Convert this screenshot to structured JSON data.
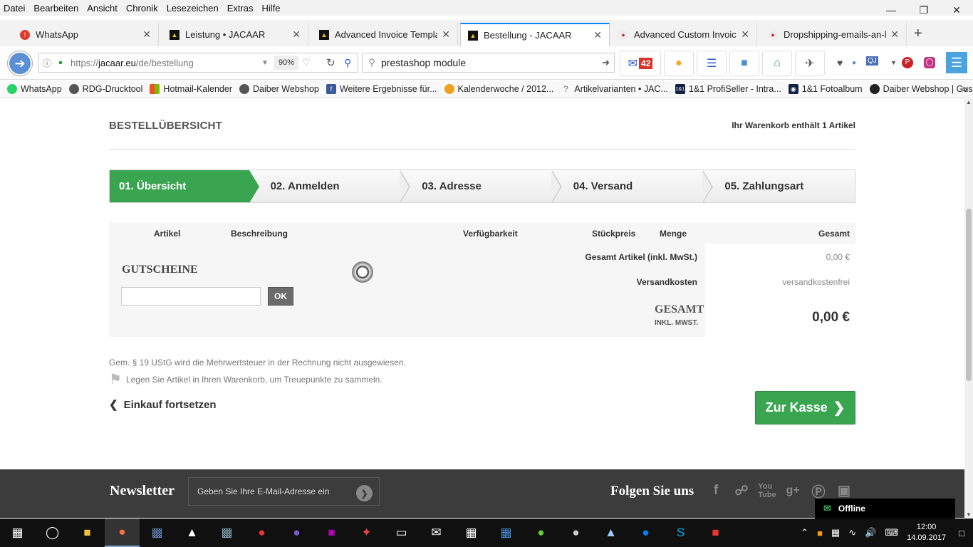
{
  "menubar": [
    "Datei",
    "Bearbeiten",
    "Ansicht",
    "Chronik",
    "Lesezeichen",
    "Extras",
    "Hilfe"
  ],
  "tabs": [
    {
      "title": "WhatsApp",
      "icon": "whatsapp-icon",
      "color": "#e03a2f"
    },
    {
      "title": "Leistung • JACAAR",
      "icon": "jacaar-icon",
      "color": "#111"
    },
    {
      "title": "Advanced Invoice Template",
      "icon": "jacaar-icon",
      "color": "#111"
    },
    {
      "title": "Bestellung - JACAAR",
      "icon": "jacaar-icon",
      "color": "#111",
      "active": true
    },
    {
      "title": "Advanced Custom Invoice, D",
      "icon": "module-icon",
      "color": "#c33"
    },
    {
      "title": "Dropshipping-emails-an-lief",
      "icon": "module-icon",
      "color": "#c33"
    }
  ],
  "url": {
    "prefix": "https://",
    "host": "jacaar.eu",
    "path": "/de/bestellung",
    "zoom": "90%"
  },
  "search": {
    "value": "prestashop module"
  },
  "mail_count": "42",
  "bookmarks": [
    {
      "label": "WhatsApp",
      "color": "#25d366"
    },
    {
      "label": "RDG-Drucktool",
      "color": "#555"
    },
    {
      "label": "Hotmail-Kalender",
      "color": "#e74"
    },
    {
      "label": "Daiber Webshop",
      "color": "#555"
    },
    {
      "label": "Weitere Ergebnisse für...",
      "color": "#3b5998"
    },
    {
      "label": "Kalenderwoche / 2012...",
      "color": "#f0a020"
    },
    {
      "label": "Artikelvarianten • JAC...",
      "color": "#999"
    },
    {
      "label": "1&1 ProfiSeller - Intra...",
      "color": "#124"
    },
    {
      "label": "1&1 Fotoalbum",
      "color": "#124"
    },
    {
      "label": "Daiber Webshop | Gus...",
      "color": "#222"
    }
  ],
  "page": {
    "title": "BESTELLÜBERSICHT",
    "cart_count": "Ihr Warenkorb enthält 1 Artikel",
    "steps": [
      "01. Übersicht",
      "02. Anmelden",
      "03. Adresse",
      "04. Versand",
      "05. Zahlungsart"
    ],
    "table_headers": {
      "artikel": "Artikel",
      "beschreibung": "Beschreibung",
      "verfuegbarkeit": "Verfügbarkeit",
      "stueckpreis": "Stückpreis",
      "menge": "Menge",
      "gesamt": "Gesamt"
    },
    "coupon_title": "GUTSCHEINE",
    "coupon_ok": "OK",
    "total_items_label": "Gesamt Artikel (inkl. MwSt.)",
    "total_items_value": "0,00 €",
    "shipping_label": "Versandkosten",
    "shipping_value": "versandkostenfrei",
    "grand_label": "GESAMT",
    "grand_sub": "INKL. MWST.",
    "grand_value": "0,00 €",
    "tax_note": "Gem. § 19 UStG wird die Mehrwertsteuer in der Rechnung nicht ausgewiesen.",
    "loyalty_note": "Legen Sie Artikel in Ihren Warenkorb, um Treuepunkte zu sammeln.",
    "continue_label": "Einkauf fortsetzen",
    "checkout_label": "Zur Kasse"
  },
  "footer": {
    "newsletter_title": "Newsletter",
    "newsletter_placeholder": "Geben Sie Ihre E-Mail-Adresse ein",
    "follow_title": "Folgen Sie uns",
    "social": [
      "facebook-icon",
      "twitter-icon",
      "youtube-icon",
      "googleplus-icon",
      "pinterest-icon",
      "instagram-icon"
    ]
  },
  "chat_status": "Offline",
  "clock": {
    "time": "12:00",
    "date": "14.09.2017"
  },
  "accent_green": "#3aa550"
}
